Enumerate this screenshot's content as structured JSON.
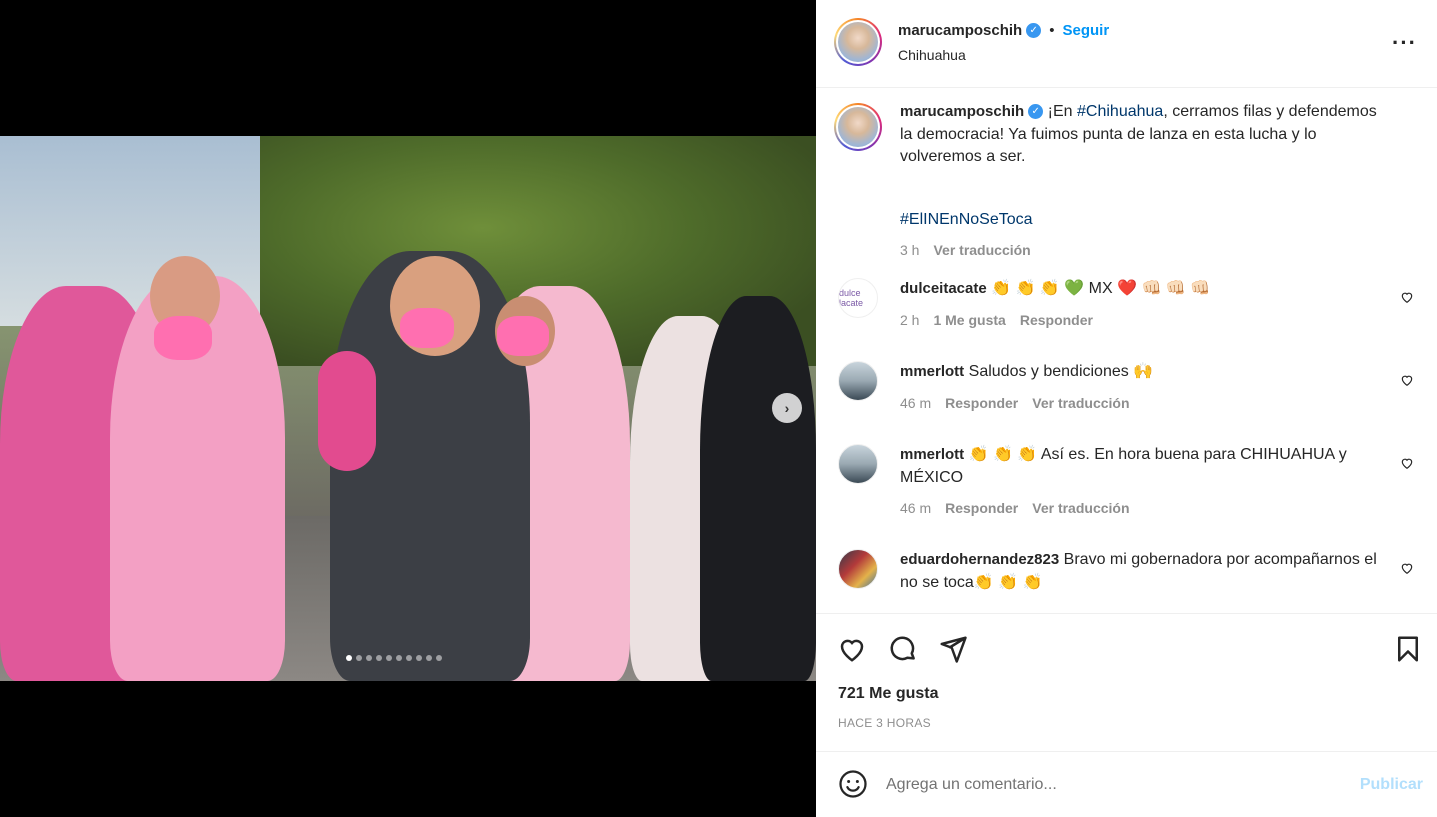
{
  "post": {
    "username": "marucamposchih",
    "verified": true,
    "separator": "•",
    "follow_label": "Seguir",
    "location": "Chihuahua",
    "more_icon": "more-horizontal-icon",
    "carousel": {
      "total_slides": 10,
      "active_slide": 1
    }
  },
  "caption": {
    "username": "marucamposchih",
    "text_prefix": "¡En ",
    "hashtag1": "#Chihuahua",
    "text_suffix": ", cerramos filas y defendemos la democracia! Ya fuimos punta de lanza en esta lucha y lo volveremos a ser.",
    "hashtag2": "#ElINEnNoSeToca",
    "time": "3 h",
    "translate": "Ver traducción"
  },
  "comments": [
    {
      "username": "dulceitacate",
      "text": "👏 👏 👏 💚 MX ❤️ 👊🏻 👊🏻 👊🏻",
      "time": "2 h",
      "likes": "1 Me gusta",
      "reply": "Responder",
      "translate": "",
      "avatar_text": "dulce lacate"
    },
    {
      "username": "mmerlott",
      "text": "Saludos y bendiciones 🙌",
      "time": "46 m",
      "likes": "",
      "reply": "Responder",
      "translate": "Ver traducción"
    },
    {
      "username": "mmerlott",
      "text": "👏 👏 👏 Así es. En hora buena para CHIHUAHUA y MÉXICO",
      "time": "46 m",
      "likes": "",
      "reply": "Responder",
      "translate": "Ver traducción"
    },
    {
      "username": "eduardohernandez823",
      "text": "Bravo mi gobernadora por acompañarnos el no se toca👏 👏 👏",
      "time": "",
      "likes": "",
      "reply": "",
      "translate": ""
    }
  ],
  "actions": {
    "likes": "721 Me gusta",
    "time": "HACE 3 HORAS",
    "icons": [
      "heart-icon",
      "comment-icon",
      "share-icon",
      "bookmark-icon"
    ]
  },
  "add_comment": {
    "placeholder": "Agrega un comentario...",
    "post_label": "Publicar",
    "emoji_icon": "emoji-icon"
  },
  "colors": {
    "link": "#0095f6",
    "hashtag": "#00376b",
    "muted": "#8e8e8e",
    "text": "#262626",
    "publish_disabled": "#b2dffc"
  }
}
